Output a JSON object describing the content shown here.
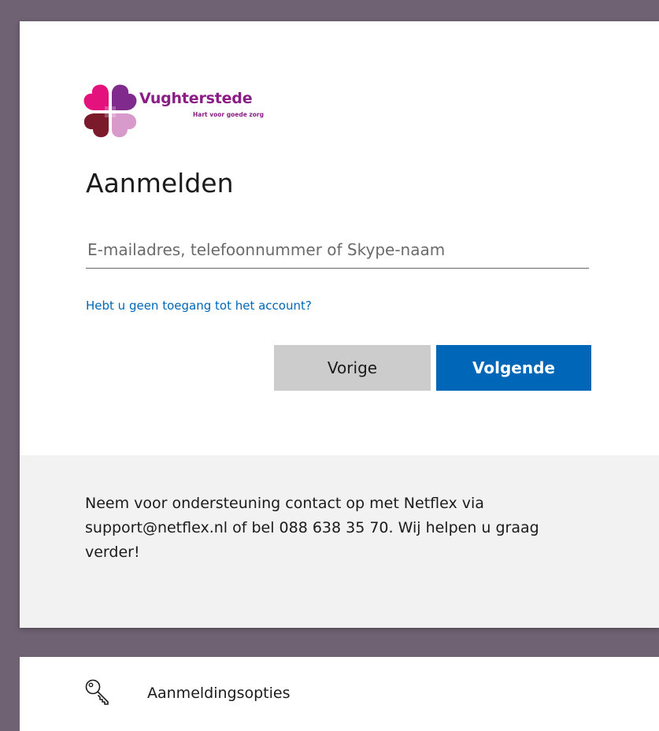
{
  "brand": {
    "name": "Vughterstede",
    "tagline": "Hart voor goede zorg",
    "colors": {
      "text": "#8a1e86",
      "petal_pink": "#e3127c",
      "petal_purple": "#7f2a8c",
      "petal_dark": "#7a1a2a",
      "petal_light": "#d79acb"
    }
  },
  "signin": {
    "title": "Aanmelden",
    "email_placeholder": "E-mailadres, telefoonnummer of Skype-naam",
    "email_value": "",
    "help_link": "Hebt u geen toegang tot het account?",
    "back_button": "Vorige",
    "next_button": "Volgende"
  },
  "footer": {
    "support_text": "Neem voor ondersteuning contact op met Netflex via support@netflex.nl of bel 088 638 35 70. Wij helpen u graag verder!"
  },
  "options": {
    "icon": "key-icon",
    "label": "Aanmeldingsopties"
  },
  "colors": {
    "backdrop": "#6e6273",
    "primary": "#0067b8",
    "secondary_button": "#cccccc",
    "footer_background": "#f2f2f2"
  }
}
